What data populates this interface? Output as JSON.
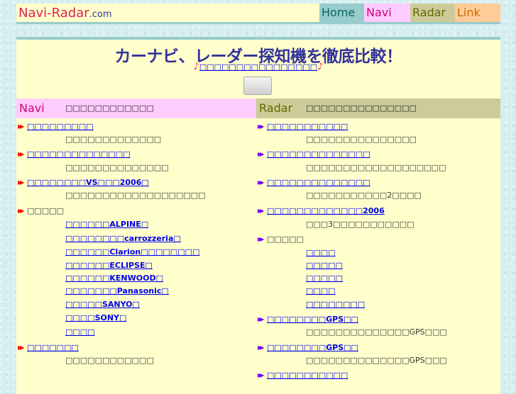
{
  "header": {
    "logo_main": "Navi-Radar",
    "logo_suffix": ".com",
    "tabs": [
      {
        "label": "Home",
        "color": "#006666",
        "bg": "#99cccc"
      },
      {
        "label": "Navi",
        "color": "#cc0077",
        "bg": "#ffccff"
      },
      {
        "label": "Radar",
        "color": "#666600",
        "bg": "#cccc99"
      },
      {
        "label": "Link",
        "color": "#cc6600",
        "bg": "#ffcc99"
      }
    ]
  },
  "hero": {
    "title": "カーナビ、レーダー探知機を徹底比較！",
    "note_icon": "♪",
    "sublink": "□□□□□□□□□□□□□□□□",
    "button_label": ""
  },
  "navi": {
    "heading": "Navi",
    "desc": "□□□□□□□□□□□□",
    "items": [
      {
        "link": "□□□□□□□□□",
        "desc": "□□□□□□□□□□□□□"
      },
      {
        "link": "□□□□□□□□□□□□□□",
        "desc": "□□□□□□□□□□□□□□"
      },
      {
        "link": "□□□□□□□□VS□□□2006□",
        "desc": "□□□□□□□□□□□□□□□□□□□"
      }
    ],
    "makers_label": "□□□□□",
    "makers": [
      "□□□□□□ALPINE□",
      "□□□□□□□□carrozzeria□",
      "□□□□□□Clarion□□□□□□□□",
      "□□□□□□ECLIPSE□",
      "□□□□□□KENWOOD□",
      "□□□□□□□Panasonic□",
      "□□□□□SANYO□",
      "□□□□SONY□",
      "□□□□"
    ],
    "last": {
      "link": "□□□□□□□",
      "desc": "□□□□□□□□□□□□"
    }
  },
  "radar": {
    "heading": "Radar",
    "desc": "□□□□□□□□□□□□□□□",
    "items": [
      {
        "link": "□□□□□□□□□□□",
        "desc": "□□□□□□□□□□□□□□□"
      },
      {
        "link": "□□□□□□□□□□□□□□",
        "desc": "□□□□□□□□□□□□□□□□□□□"
      },
      {
        "link": "□□□□□□□□□□□□□□",
        "desc": "□□□□□□□□□□□2□□□□"
      },
      {
        "link": "□□□□□□□□□□□□□2006",
        "desc": "□□□3□□□□□□□□□□□"
      }
    ],
    "makers_label": "□□□□□",
    "makers": [
      "□□□□",
      "□□□□□",
      "□□□□□",
      "□□□□",
      "□□□□□□□□"
    ],
    "gps": [
      {
        "link": "□□□□□□□□GPS□□",
        "desc": "□□□□□□□□□□□□□□GPS□□□"
      },
      {
        "link": "□□□□□□□□GPS□□",
        "desc": "□□□□□□□□□□□□□□GPS□□□"
      }
    ],
    "last": {
      "link": "□□□□□□□□□□□"
    }
  },
  "colors": {
    "navi_arrow": "#ff0000",
    "radar_arrow": "#7700ee"
  }
}
